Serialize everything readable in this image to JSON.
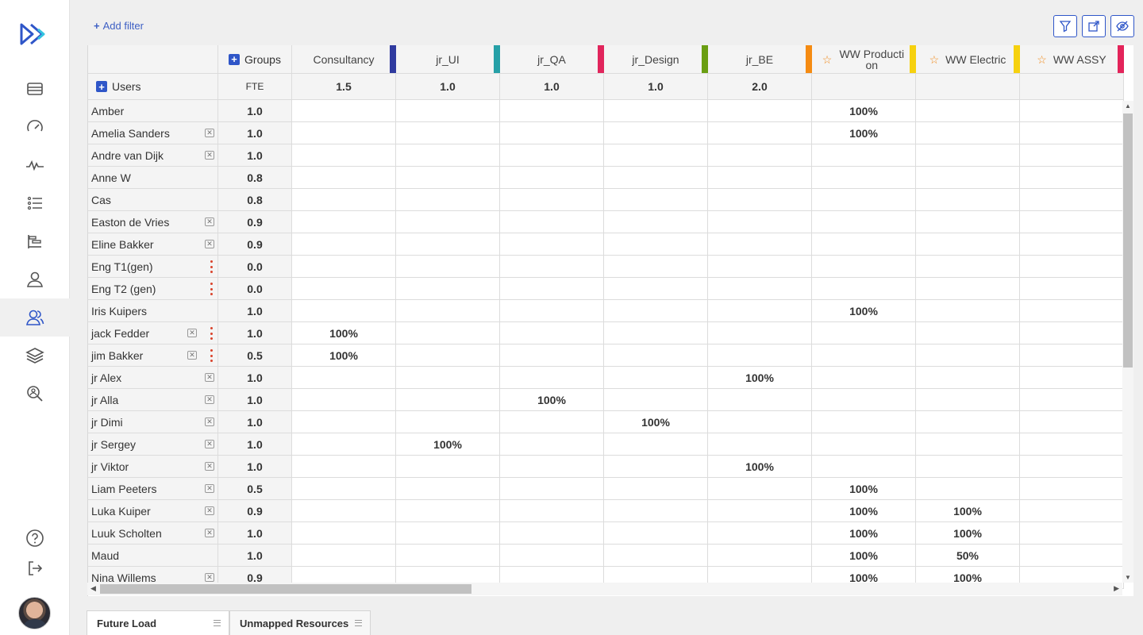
{
  "nav": {
    "items": [
      {
        "name": "nav-projects",
        "icon": "table-icon"
      },
      {
        "name": "nav-dashboard",
        "icon": "speedometer-icon"
      },
      {
        "name": "nav-activity",
        "icon": "pulse-icon"
      },
      {
        "name": "nav-list",
        "icon": "list-icon"
      },
      {
        "name": "nav-timeline",
        "icon": "gantt-icon"
      },
      {
        "name": "nav-user",
        "icon": "user-icon"
      },
      {
        "name": "nav-resources",
        "icon": "users-icon"
      },
      {
        "name": "nav-layers",
        "icon": "layers-icon"
      },
      {
        "name": "nav-search",
        "icon": "search-people-icon"
      }
    ],
    "active_index": 6,
    "help_icon": "help-icon",
    "logout_icon": "logout-icon"
  },
  "toolbar": {
    "add_filter_label": "Add filter",
    "buttons": [
      "filter-icon",
      "export-icon",
      "hide-icon"
    ]
  },
  "grid": {
    "groups_label": "Groups",
    "users_label": "Users",
    "fte_label": "FTE",
    "columns": [
      {
        "label": "Consultancy",
        "fte": "1.5",
        "color": "#2f3a9f",
        "star": false
      },
      {
        "label": "jr_UI",
        "fte": "1.0",
        "color": "#26a0a7",
        "star": false
      },
      {
        "label": "jr_QA",
        "fte": "1.0",
        "color": "#e1255c",
        "star": false
      },
      {
        "label": "jr_Design",
        "fte": "1.0",
        "color": "#6a9e12",
        "star": false
      },
      {
        "label": "jr_BE",
        "fte": "2.0",
        "color": "#f58b12",
        "star": false
      },
      {
        "label": "WW Producti on",
        "fte": "",
        "color": "#f6d10f",
        "star": true
      },
      {
        "label": "WW Electric",
        "fte": "",
        "color": "#f6d10f",
        "star": true
      },
      {
        "label": "WW ASSY",
        "fte": "",
        "color": "#e3245a",
        "star": true
      }
    ],
    "rows": [
      {
        "name": "Amber",
        "fte": "1.0",
        "x": false,
        "dots": false,
        "values": [
          "",
          "",
          "",
          "",
          "",
          "100%",
          "",
          ""
        ]
      },
      {
        "name": "Amelia Sanders",
        "fte": "1.0",
        "x": true,
        "dots": false,
        "values": [
          "",
          "",
          "",
          "",
          "",
          "100%",
          "",
          ""
        ]
      },
      {
        "name": "Andre van Dijk",
        "fte": "1.0",
        "x": true,
        "dots": false,
        "values": [
          "",
          "",
          "",
          "",
          "",
          "",
          "",
          ""
        ]
      },
      {
        "name": "Anne W",
        "fte": "0.8",
        "x": false,
        "dots": false,
        "values": [
          "",
          "",
          "",
          "",
          "",
          "",
          "",
          ""
        ]
      },
      {
        "name": "Cas",
        "fte": "0.8",
        "x": false,
        "dots": false,
        "values": [
          "",
          "",
          "",
          "",
          "",
          "",
          "",
          ""
        ]
      },
      {
        "name": "Easton de Vries",
        "fte": "0.9",
        "x": true,
        "dots": false,
        "values": [
          "",
          "",
          "",
          "",
          "",
          "",
          "",
          ""
        ]
      },
      {
        "name": "Eline Bakker",
        "fte": "0.9",
        "x": true,
        "dots": false,
        "values": [
          "",
          "",
          "",
          "",
          "",
          "",
          "",
          ""
        ]
      },
      {
        "name": "Eng T1(gen)",
        "fte": "0.0",
        "x": false,
        "dots": true,
        "values": [
          "",
          "",
          "",
          "",
          "",
          "",
          "",
          ""
        ]
      },
      {
        "name": "Eng T2 (gen)",
        "fte": "0.0",
        "x": false,
        "dots": true,
        "values": [
          "",
          "",
          "",
          "",
          "",
          "",
          "",
          ""
        ]
      },
      {
        "name": "Iris Kuipers",
        "fte": "1.0",
        "x": false,
        "dots": false,
        "values": [
          "",
          "",
          "",
          "",
          "",
          "100%",
          "",
          ""
        ]
      },
      {
        "name": "jack Fedder",
        "fte": "1.0",
        "x": true,
        "dots": true,
        "values": [
          "100%",
          "",
          "",
          "",
          "",
          "",
          "",
          ""
        ]
      },
      {
        "name": "jim Bakker",
        "fte": "0.5",
        "x": true,
        "dots": true,
        "values": [
          "100%",
          "",
          "",
          "",
          "",
          "",
          "",
          ""
        ]
      },
      {
        "name": "jr Alex",
        "fte": "1.0",
        "x": true,
        "dots": false,
        "values": [
          "",
          "",
          "",
          "",
          "100%",
          "",
          "",
          ""
        ]
      },
      {
        "name": "jr Alla",
        "fte": "1.0",
        "x": true,
        "dots": false,
        "values": [
          "",
          "",
          "100%",
          "",
          "",
          "",
          "",
          ""
        ]
      },
      {
        "name": "jr Dimi",
        "fte": "1.0",
        "x": true,
        "dots": false,
        "values": [
          "",
          "",
          "",
          "100%",
          "",
          "",
          "",
          ""
        ]
      },
      {
        "name": "jr Sergey",
        "fte": "1.0",
        "x": true,
        "dots": false,
        "values": [
          "",
          "100%",
          "",
          "",
          "",
          "",
          "",
          ""
        ]
      },
      {
        "name": "jr Viktor",
        "fte": "1.0",
        "x": true,
        "dots": false,
        "values": [
          "",
          "",
          "",
          "",
          "100%",
          "",
          "",
          ""
        ]
      },
      {
        "name": "Liam Peeters",
        "fte": "0.5",
        "x": true,
        "dots": false,
        "values": [
          "",
          "",
          "",
          "",
          "",
          "100%",
          "",
          ""
        ]
      },
      {
        "name": "Luka Kuiper",
        "fte": "0.9",
        "x": true,
        "dots": false,
        "values": [
          "",
          "",
          "",
          "",
          "",
          "100%",
          "100%",
          ""
        ]
      },
      {
        "name": "Luuk Scholten",
        "fte": "1.0",
        "x": true,
        "dots": false,
        "values": [
          "",
          "",
          "",
          "",
          "",
          "100%",
          "100%",
          ""
        ]
      },
      {
        "name": "Maud",
        "fte": "1.0",
        "x": false,
        "dots": false,
        "values": [
          "",
          "",
          "",
          "",
          "",
          "100%",
          "50%",
          ""
        ]
      },
      {
        "name": "Nina Willems",
        "fte": "0.9",
        "x": true,
        "dots": false,
        "values": [
          "",
          "",
          "",
          "",
          "",
          "100%",
          "100%",
          ""
        ]
      }
    ]
  },
  "tabs": [
    {
      "label": "Future Load",
      "active": true
    },
    {
      "label": "Unmapped Resources",
      "active": false
    }
  ]
}
